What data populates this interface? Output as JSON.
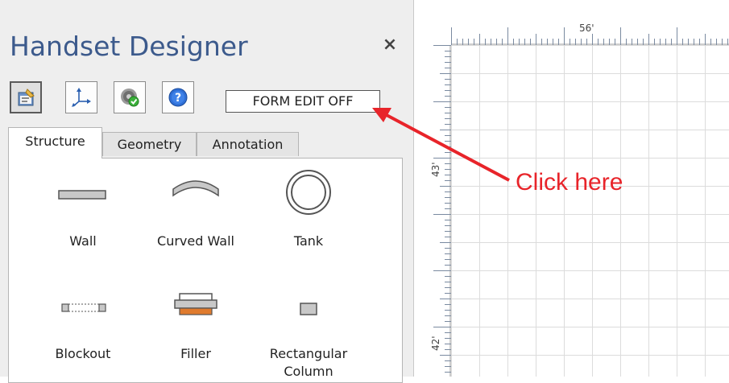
{
  "panel": {
    "title": "Handset Designer",
    "close_label": "×",
    "toolbar": {
      "buttons": [
        {
          "icon": "properties-icon"
        },
        {
          "icon": "axes-icon"
        },
        {
          "icon": "settings-gear-icon"
        },
        {
          "icon": "help-icon"
        }
      ],
      "form_edit_label": "FORM EDIT OFF"
    },
    "tabs": [
      "Structure",
      "Geometry",
      "Annotation"
    ],
    "active_tab": "Structure",
    "items": [
      {
        "label": "Wall",
        "icon": "wall-icon"
      },
      {
        "label": "Curved Wall",
        "icon": "curved-wall-icon"
      },
      {
        "label": "Tank",
        "icon": "tank-icon"
      },
      {
        "label": "Blockout",
        "icon": "blockout-icon"
      },
      {
        "label": "Filler",
        "icon": "filler-icon"
      },
      {
        "label": "Rectangular Column",
        "icon": "rectangular-column-icon"
      }
    ]
  },
  "canvas": {
    "ruler_top_label": "56'",
    "ruler_left_labels": [
      "43'",
      "42'"
    ]
  },
  "annotation": {
    "callout_text": "Click here",
    "color": "#e8242a"
  },
  "colors": {
    "title": "#3c5a8c",
    "panel_bg": "#eeeeee",
    "grid_line": "#dcdcdc"
  }
}
